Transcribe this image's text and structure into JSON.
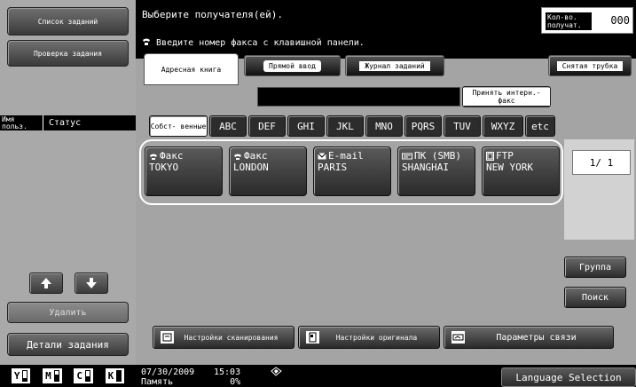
{
  "left_panel": {
    "job_list_label": "Список заданий",
    "check_job_label": "Проверка задания",
    "column_user": "Имя польз.",
    "column_status": "Статус",
    "delete_label": "Удалить",
    "job_details_label": "Детали задания",
    "toner": [
      {
        "letter": "Y",
        "level": 0.3
      },
      {
        "letter": "M",
        "level": 0.6
      },
      {
        "letter": "C",
        "level": 0.5
      },
      {
        "letter": "K",
        "level": 1.0
      }
    ]
  },
  "header": {
    "instruction": "Выберите получателя(ей).",
    "hint": "Введите номер факса с клавишной панели.",
    "recipients_label": "Кол-во. получат.",
    "recipients_count": "000"
  },
  "tabs": [
    {
      "label": "Адресная книга",
      "active": true
    },
    {
      "label": "Прямой ввод",
      "active": false
    },
    {
      "label": "Журнал заданий",
      "active": false
    },
    {
      "label": "Снятая трубка",
      "active": false
    }
  ],
  "internet_fax_label": "Принять интерн.-факс",
  "index_tabs": [
    "Собст- венные",
    "ABC",
    "DEF",
    "GHI",
    "JKL",
    "MNO",
    "PQRS",
    "TUV",
    "WXYZ",
    "etc"
  ],
  "destinations": [
    {
      "type": "Факс",
      "icon": "fax-icon",
      "name": "TOKYO"
    },
    {
      "type": "Факс",
      "icon": "fax-icon",
      "name": "LONDON"
    },
    {
      "type": "E-mail",
      "icon": "email-icon",
      "name": "PARIS"
    },
    {
      "type": "ПК (SMB)",
      "icon": "pc-icon",
      "name": "SHANGHAI"
    },
    {
      "type": "FTP",
      "icon": "ftp-icon",
      "name": "NEW YORK"
    }
  ],
  "page_indicator": "1/ 1",
  "group_label": "Группа",
  "search_label": "Поиск",
  "bottom_buttons": {
    "scan_settings": "Настройки сканирования",
    "original_settings": "Настройки оригинала",
    "comm_settings": "Параметры связи"
  },
  "status": {
    "date": "07/30/2009",
    "time": "15:03",
    "memory_label": "Память",
    "memory_value": "0%"
  },
  "language_label": "Language Selection"
}
